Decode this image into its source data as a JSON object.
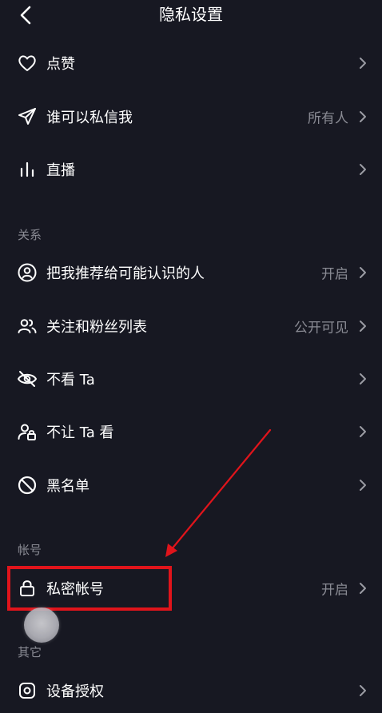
{
  "header": {
    "title": "隐私设置",
    "back_icon": "chevron-left-icon"
  },
  "sections": {
    "relations": "关系",
    "account": "帐号",
    "other": "其它"
  },
  "rows": [
    {
      "icon": "heart-icon",
      "label": "点赞",
      "value": ""
    },
    {
      "icon": "send-icon",
      "label": "谁可以私信我",
      "value": "所有人"
    },
    {
      "icon": "bars-icon",
      "label": "直播",
      "value": ""
    },
    {
      "icon": "user-circle-icon",
      "label": "把我推荐给可能认识的人",
      "value": "开启"
    },
    {
      "icon": "users-icon",
      "label": "关注和粉丝列表",
      "value": "公开可见"
    },
    {
      "icon": "eye-off-icon",
      "label": "不看 Ta",
      "value": ""
    },
    {
      "icon": "user-lock-icon",
      "label": "不让 Ta 看",
      "value": ""
    },
    {
      "icon": "block-icon",
      "label": "黑名单",
      "value": ""
    },
    {
      "icon": "lock-icon",
      "label": "私密帐号",
      "value": "开启"
    },
    {
      "icon": "device-auth-icon",
      "label": "设备授权",
      "value": ""
    }
  ],
  "colors": {
    "background": "#171822",
    "text": "#ffffff",
    "secondary_text": "#8a8b94",
    "annotation_red": "#e0141b"
  }
}
